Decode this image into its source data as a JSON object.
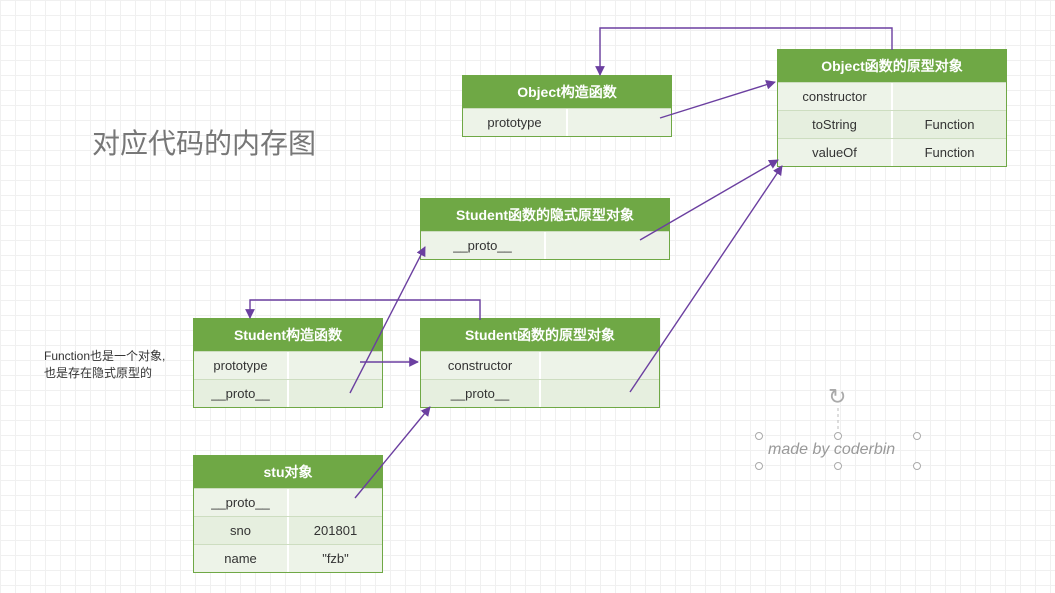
{
  "title": "对应代码的内存图",
  "note": "Function也是一个对象,\n也是存在隐式原型的",
  "watermark": "made by coderbin",
  "boxes": {
    "objectCtor": {
      "header": "Object构造函数",
      "rows": [
        [
          "prototype",
          ""
        ]
      ]
    },
    "objectProto": {
      "header": "Object函数的原型对象",
      "rows": [
        [
          "constructor",
          ""
        ],
        [
          "toString",
          "Function"
        ],
        [
          "valueOf",
          "Function"
        ]
      ]
    },
    "studentImplicit": {
      "header": "Student函数的隐式原型对象",
      "rows": [
        [
          "__proto__",
          ""
        ]
      ]
    },
    "studentCtor": {
      "header": "Student构造函数",
      "rows": [
        [
          "prototype",
          ""
        ],
        [
          "__proto__",
          ""
        ]
      ]
    },
    "studentProto": {
      "header": "Student函数的原型对象",
      "rows": [
        [
          "constructor",
          ""
        ],
        [
          "__proto__",
          ""
        ]
      ]
    },
    "stu": {
      "header": "stu对象",
      "rows": [
        [
          "__proto__",
          ""
        ],
        [
          "sno",
          "201801"
        ],
        [
          "name",
          "\"fzb\""
        ]
      ]
    }
  },
  "chart_data": {
    "type": "diagram",
    "title": "对应代码的内存图",
    "nodes": [
      {
        "id": "objectCtor",
        "label": "Object构造函数",
        "fields": [
          {
            "key": "prototype",
            "value": ""
          }
        ]
      },
      {
        "id": "objectProto",
        "label": "Object函数的原型对象",
        "fields": [
          {
            "key": "constructor",
            "value": ""
          },
          {
            "key": "toString",
            "value": "Function"
          },
          {
            "key": "valueOf",
            "value": "Function"
          }
        ]
      },
      {
        "id": "studentImplicit",
        "label": "Student函数的隐式原型对象",
        "fields": [
          {
            "key": "__proto__",
            "value": ""
          }
        ]
      },
      {
        "id": "studentCtor",
        "label": "Student构造函数",
        "fields": [
          {
            "key": "prototype",
            "value": ""
          },
          {
            "key": "__proto__",
            "value": ""
          }
        ]
      },
      {
        "id": "studentProto",
        "label": "Student函数的原型对象",
        "fields": [
          {
            "key": "constructor",
            "value": ""
          },
          {
            "key": "__proto__",
            "value": ""
          }
        ]
      },
      {
        "id": "stu",
        "label": "stu对象",
        "fields": [
          {
            "key": "__proto__",
            "value": ""
          },
          {
            "key": "sno",
            "value": "201801"
          },
          {
            "key": "name",
            "value": "\"fzb\""
          }
        ]
      }
    ],
    "edges": [
      {
        "from": "objectCtor.prototype",
        "to": "objectProto"
      },
      {
        "from": "objectProto.constructor",
        "to": "objectCtor"
      },
      {
        "from": "studentCtor.prototype",
        "to": "studentProto"
      },
      {
        "from": "studentCtor.__proto__",
        "to": "studentImplicit"
      },
      {
        "from": "studentProto.constructor",
        "to": "studentCtor"
      },
      {
        "from": "studentProto.__proto__",
        "to": "objectProto"
      },
      {
        "from": "studentImplicit.__proto__",
        "to": "objectProto"
      },
      {
        "from": "stu.__proto__",
        "to": "studentProto"
      }
    ],
    "annotations": [
      "Function也是一个对象, 也是存在隐式原型的"
    ],
    "watermark": "made by coderbin"
  }
}
